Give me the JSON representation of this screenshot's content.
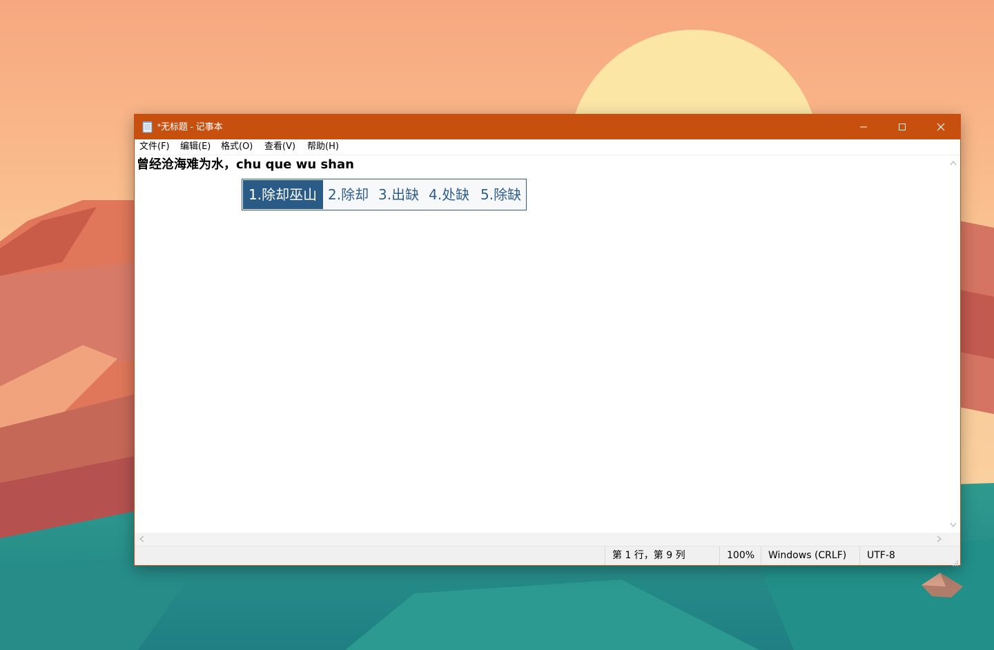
{
  "window": {
    "title": "*无标题 - 记事本",
    "accent_color": "#c8500f",
    "controls": {
      "minimize_icon": "minimize-icon",
      "maximize_icon": "maximize-icon",
      "close_icon": "close-icon"
    }
  },
  "menu": {
    "items": [
      {
        "label": "文件(F)"
      },
      {
        "label": "编辑(E)"
      },
      {
        "label": "格式(O)"
      },
      {
        "label": "查看(V)"
      },
      {
        "label": "帮助(H)"
      }
    ]
  },
  "editor": {
    "content": "曾经沧海难为水，chu que wu shan"
  },
  "ime": {
    "candidates": [
      {
        "label": "1.除却巫山",
        "selected": true
      },
      {
        "label": "2.除却",
        "selected": false
      },
      {
        "label": "3.出缺",
        "selected": false
      },
      {
        "label": "4.处缺",
        "selected": false
      },
      {
        "label": "5.除缺",
        "selected": false
      }
    ]
  },
  "status": {
    "position": "第 1 行，第 9 列",
    "zoom": "100%",
    "line_ending": "Windows (CRLF)",
    "encoding": "UTF-8"
  }
}
